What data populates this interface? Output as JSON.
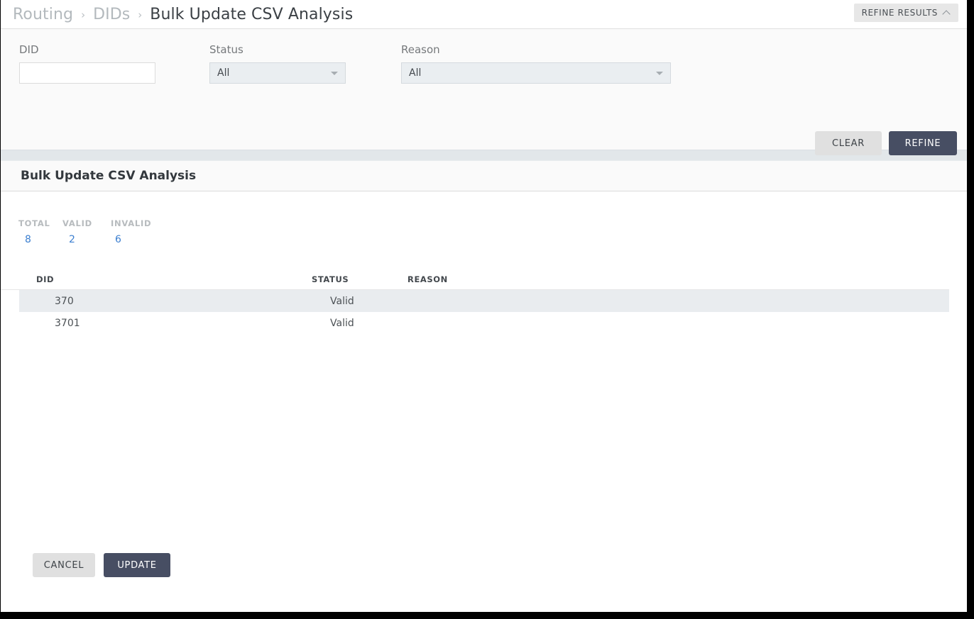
{
  "breadcrumb": {
    "items": [
      {
        "label": "Routing",
        "current": false
      },
      {
        "label": "DIDs",
        "current": false
      },
      {
        "label": "Bulk Update CSV Analysis",
        "current": true
      }
    ],
    "separator": "›"
  },
  "header": {
    "refine_results_label": "REFINE RESULTS",
    "refine_results_icon": "chevron-up-icon"
  },
  "filters": {
    "did": {
      "label": "DID",
      "value": "",
      "placeholder": ""
    },
    "status": {
      "label": "Status",
      "value": "All",
      "icon": "chevron-down-icon"
    },
    "reason": {
      "label": "Reason",
      "value": "All",
      "icon": "chevron-down-icon"
    },
    "clear_label": "CLEAR",
    "refine_label": "REFINE"
  },
  "panel": {
    "title": "Bulk Update CSV Analysis",
    "stats": [
      {
        "label": "TOTAL",
        "value": "8"
      },
      {
        "label": "VALID",
        "value": "2"
      },
      {
        "label": "INVALID",
        "value": "6"
      }
    ],
    "table": {
      "columns": [
        "DID",
        "STATUS",
        "REASON"
      ],
      "rows": [
        {
          "did": "370",
          "status": "Valid",
          "reason": ""
        },
        {
          "did": "3701",
          "status": "Valid",
          "reason": ""
        }
      ]
    }
  },
  "footer": {
    "cancel_label": "CANCEL",
    "update_label": "UPDATE"
  },
  "colors": {
    "primary": "#474e63",
    "link": "#3c7fd0",
    "band": "#e2e7ea",
    "row_alt": "#e9ecef"
  }
}
